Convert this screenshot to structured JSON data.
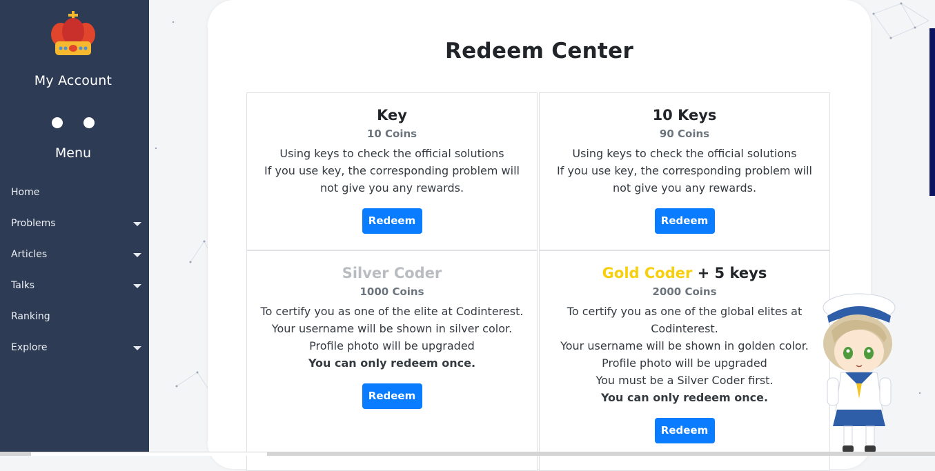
{
  "sidebar": {
    "account_title": "My Account",
    "menu_title": "Menu",
    "items": [
      {
        "label": "Home",
        "has_caret": false
      },
      {
        "label": "Problems",
        "has_caret": true
      },
      {
        "label": "Articles",
        "has_caret": true
      },
      {
        "label": "Talks",
        "has_caret": true
      },
      {
        "label": "Ranking",
        "has_caret": false
      },
      {
        "label": "Explore",
        "has_caret": true
      }
    ]
  },
  "main": {
    "title": "Redeem Center",
    "products": [
      {
        "name": "Key",
        "price": "10 Coins",
        "lines": [
          "Using keys to check the official solutions",
          "If you use key, the corresponding problem will not give you any rewards."
        ],
        "button": "Redeem"
      },
      {
        "name": "10 Keys",
        "price": "90 Coins",
        "lines": [
          "Using keys to check the official solutions",
          "If you use key, the corresponding problem will not give you any rewards."
        ],
        "button": "Redeem"
      },
      {
        "name": "Silver Coder",
        "price": "1000 Coins",
        "lines": [
          "To certify you as one of the elite at Codinterest.",
          "Your username will be shown in silver color.",
          "Profile photo will be upgraded"
        ],
        "bold_line": "You can only redeem once.",
        "button": "Redeem"
      },
      {
        "name": "Gold Coder",
        "name_suffix": " + 5 keys",
        "price": "2000 Coins",
        "lines": [
          "To certify you as one of the global elites at Codinterest.",
          "Your username will be shown in golden color.",
          "Profile photo will be upgraded",
          "You must be a Silver Coder first."
        ],
        "bold_line": "You can only redeem once.",
        "button": "Redeem"
      }
    ]
  },
  "colors": {
    "sidebar_bg": "#2d3b55",
    "button_blue": "#0a7cff",
    "silver": "#b9bcc1",
    "gold": "#f7cf0d"
  },
  "icons": {
    "logo": "crown-icon",
    "caret": "caret-down-icon",
    "mascot": "mascot-character"
  }
}
